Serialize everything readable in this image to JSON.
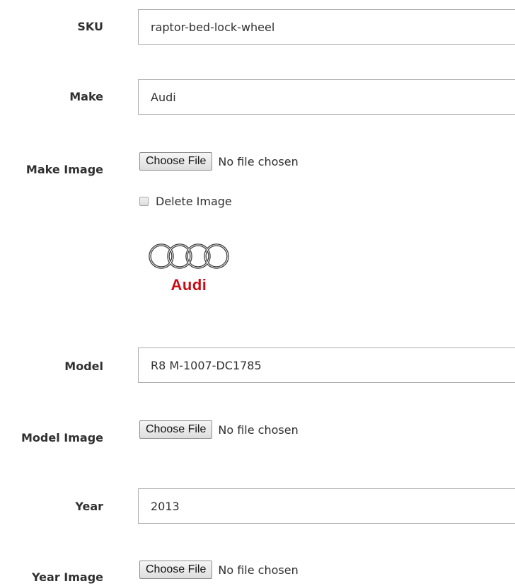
{
  "form": {
    "sku": {
      "label": "SKU",
      "value": "raptor-bed-lock-wheel"
    },
    "make": {
      "label": "Make",
      "value": "Audi"
    },
    "make_image": {
      "label": "Make Image",
      "button_label": "Choose File",
      "file_status": "No file chosen",
      "delete_label": "Delete Image",
      "preview_logo_text": "Audi",
      "preview_icon": "audi-rings-logo"
    },
    "model": {
      "label": "Model",
      "value": "R8 M-1007-DC1785"
    },
    "model_image": {
      "label": "Model Image",
      "button_label": "Choose File",
      "file_status": "No file chosen"
    },
    "year": {
      "label": "Year",
      "value": "2013"
    },
    "year_image": {
      "label": "Year Image",
      "button_label": "Choose File",
      "file_status": "No file chosen"
    }
  },
  "colors": {
    "logo_red": "#cc0b14",
    "input_border": "#adadad",
    "label_text": "#303030"
  }
}
